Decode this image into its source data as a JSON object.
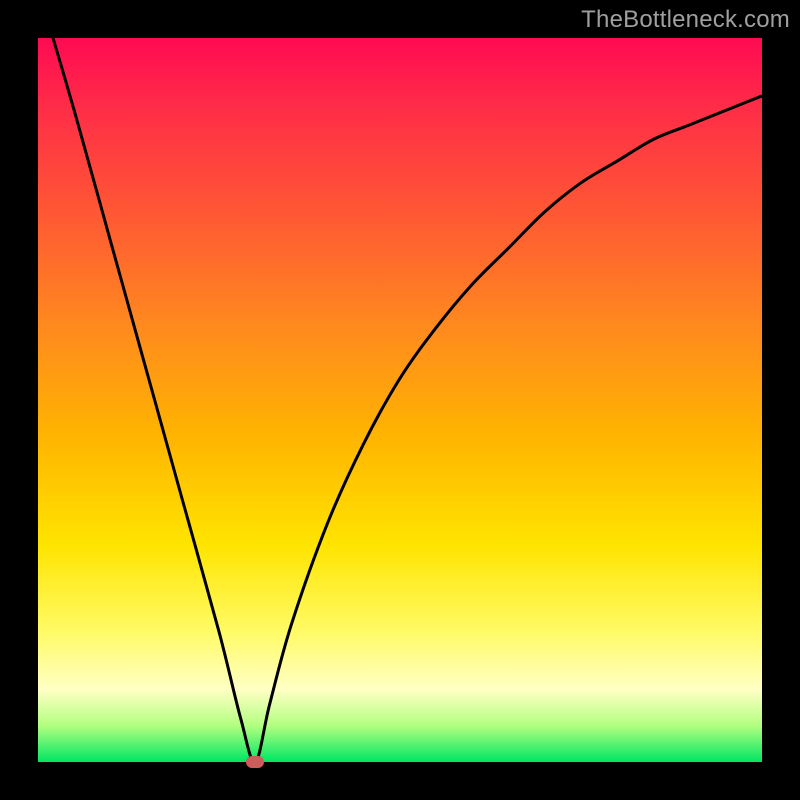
{
  "watermark": {
    "text": "TheBottleneck.com"
  },
  "colors": {
    "frame": "#000000",
    "gradient_stops": [
      "#ff0a52",
      "#ff2e47",
      "#ff5a33",
      "#ff8a1e",
      "#ffb400",
      "#ffe400",
      "#fffb66",
      "#ffffc4",
      "#b2ff80",
      "#00e663"
    ],
    "curve": "#000000",
    "marker": "#cd5c5c"
  },
  "chart_data": {
    "type": "line",
    "title": "",
    "xlabel": "",
    "ylabel": "",
    "xlim": [
      0,
      100
    ],
    "ylim": [
      0,
      100
    ],
    "grid": false,
    "legend": false,
    "annotations": [
      "TheBottleneck.com"
    ],
    "marker": {
      "x": 30,
      "y": 0
    },
    "series": [
      {
        "name": "left-branch",
        "x": [
          0,
          5,
          10,
          15,
          20,
          25,
          28,
          30
        ],
        "values": [
          107,
          90,
          72,
          54,
          36,
          18,
          6,
          0
        ]
      },
      {
        "name": "right-branch",
        "x": [
          30,
          32,
          35,
          40,
          45,
          50,
          55,
          60,
          65,
          70,
          75,
          80,
          85,
          90,
          95,
          100
        ],
        "values": [
          0,
          8,
          19,
          33,
          44,
          53,
          60,
          66,
          71,
          76,
          80,
          83,
          86,
          88,
          90,
          92
        ]
      }
    ]
  }
}
